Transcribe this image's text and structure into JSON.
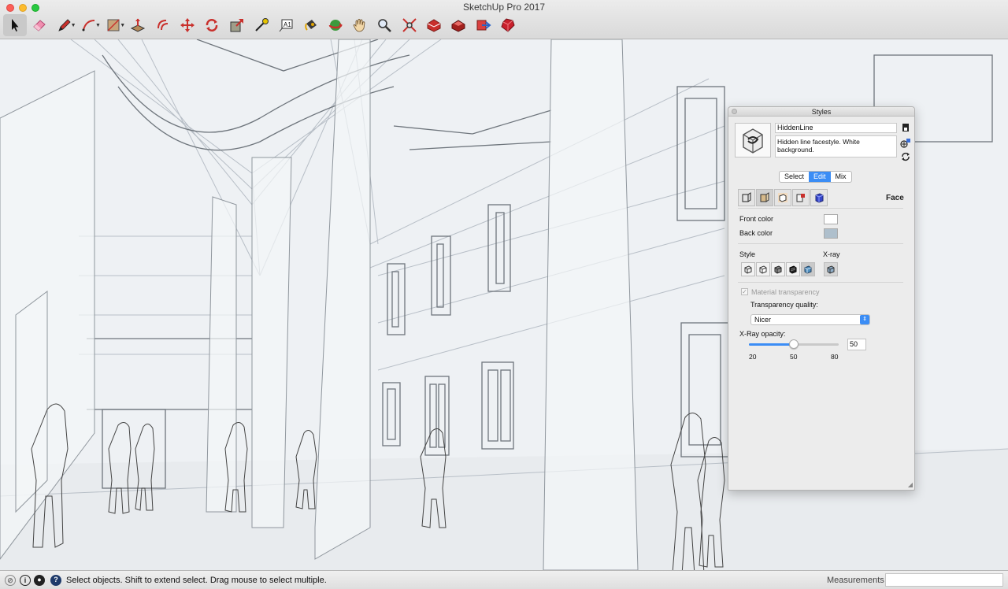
{
  "app": {
    "title": "SketchUp Pro 2017"
  },
  "toolbar": {
    "tools": [
      {
        "name": "select-tool",
        "icon": "arrow-cursor-icon",
        "selected": true
      },
      {
        "name": "eraser-tool",
        "icon": "eraser-icon"
      },
      {
        "name": "pencil-tool",
        "icon": "pencil-icon",
        "dropdown": true
      },
      {
        "name": "arc-tool",
        "icon": "arc-icon",
        "dropdown": true
      },
      {
        "name": "shape-tool",
        "icon": "rectangle-icon",
        "dropdown": true
      },
      {
        "name": "push-pull-tool",
        "icon": "push-pull-icon"
      },
      {
        "name": "offset-tool",
        "icon": "offset-icon"
      },
      {
        "name": "move-tool",
        "icon": "move-icon"
      },
      {
        "name": "rotate-tool",
        "icon": "rotate-icon"
      },
      {
        "name": "scale-tool",
        "icon": "scale-icon"
      },
      {
        "name": "tape-measure-tool",
        "icon": "tape-measure-icon"
      },
      {
        "name": "text-tool",
        "icon": "text-icon"
      },
      {
        "name": "paint-bucket-tool",
        "icon": "paint-bucket-icon"
      },
      {
        "name": "orbit-tool",
        "icon": "orbit-icon"
      },
      {
        "name": "pan-tool",
        "icon": "hand-icon"
      },
      {
        "name": "zoom-tool",
        "icon": "magnifier-icon"
      },
      {
        "name": "zoom-extents-tool",
        "icon": "zoom-extents-icon"
      },
      {
        "name": "warehouse-tool",
        "icon": "warehouse-icon"
      },
      {
        "name": "extension-warehouse-tool",
        "icon": "extension-warehouse-icon"
      },
      {
        "name": "share-model-tool",
        "icon": "share-model-icon"
      },
      {
        "name": "ruby-tool",
        "icon": "ruby-gem-icon"
      }
    ]
  },
  "styles_panel": {
    "title": "Styles",
    "style_name": "HiddenLine",
    "style_description": "Hidden line facestyle. White background.",
    "tabs": [
      {
        "label": "Select",
        "active": false
      },
      {
        "label": "Edit",
        "active": true
      },
      {
        "label": "Mix",
        "active": false
      }
    ],
    "section_label": "Face",
    "front_color_label": "Front color",
    "back_color_label": "Back color",
    "front_color": "#ffffff",
    "back_color": "#aebfcc",
    "style_label": "Style",
    "xray_label": "X-ray",
    "material_transparency_label": "Material transparency",
    "material_transparency_checked": true,
    "material_transparency_enabled": false,
    "transparency_quality_label": "Transparency quality:",
    "transparency_quality_value": "Nicer",
    "xray_opacity_label": "X-Ray opacity:",
    "xray_opacity_value": "50",
    "slider_fraction": 0.5,
    "slider_ticks": [
      "20",
      "50",
      "80"
    ]
  },
  "statusbar": {
    "message": "Select objects. Shift to extend select. Drag mouse to select multiple.",
    "measurements_label": "Measurements",
    "measurements_value": ""
  },
  "colors": {
    "accent": "#3b8df5",
    "viewport_bg": "#eef1f4"
  }
}
